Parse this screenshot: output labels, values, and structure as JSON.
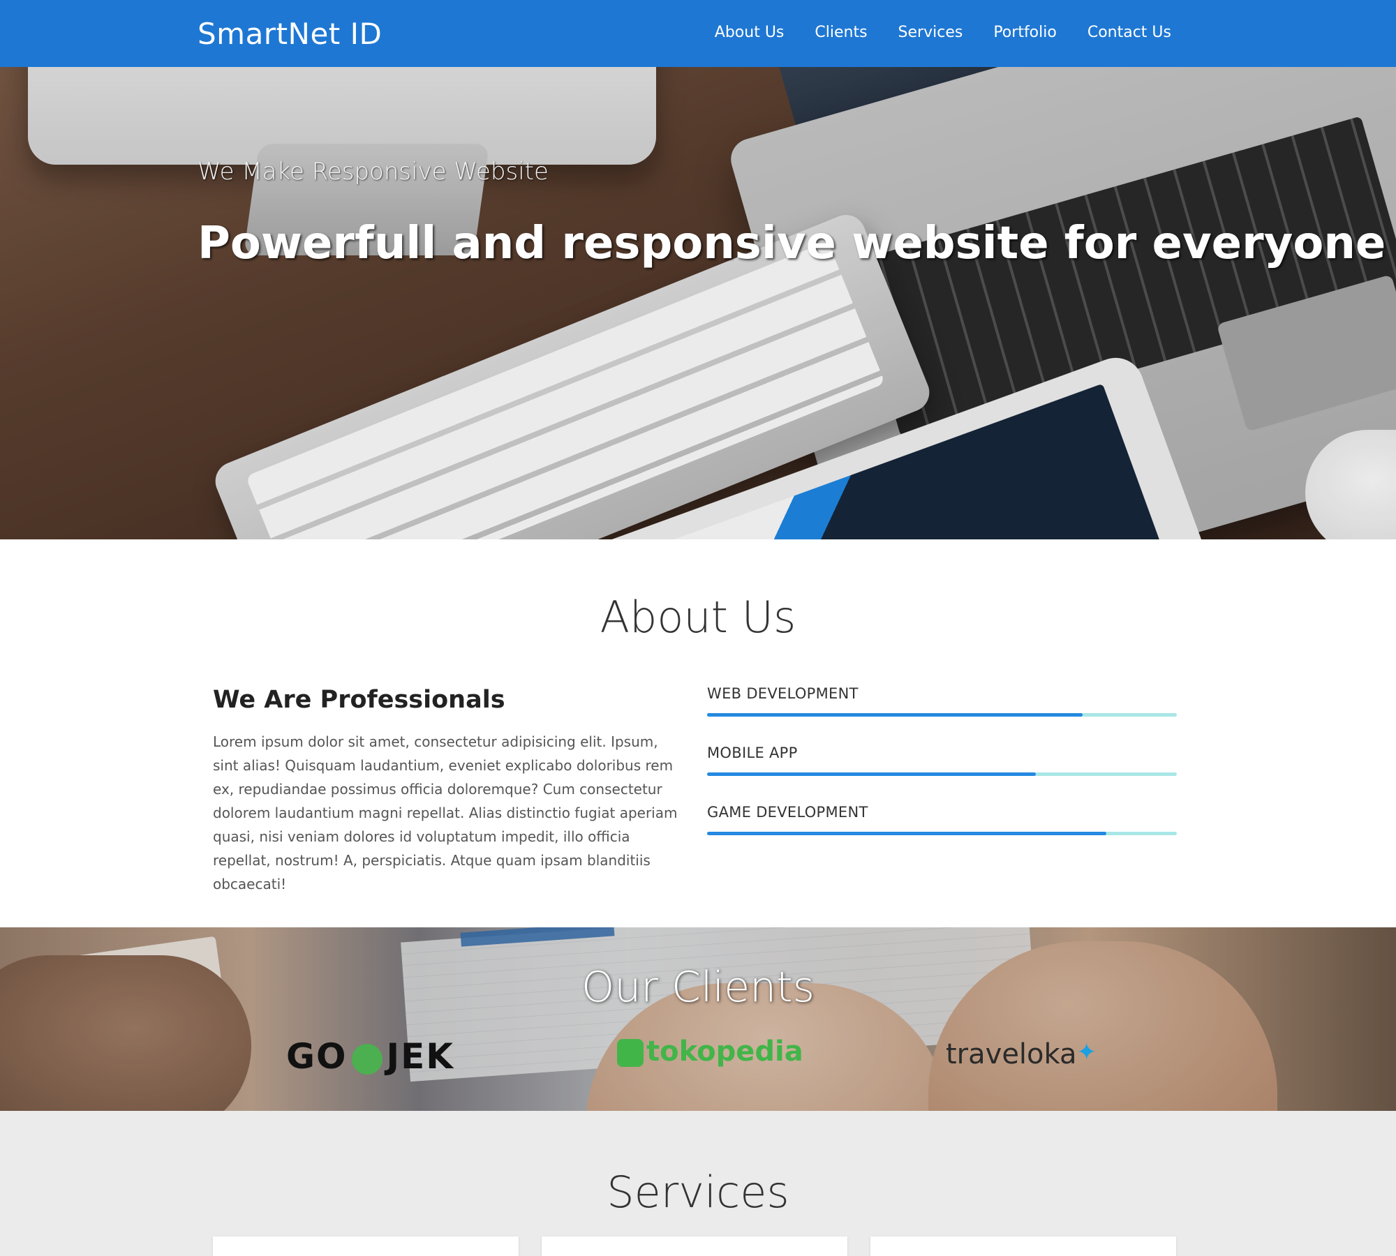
{
  "navbar": {
    "brand": "SmartNet ID",
    "links": [
      "About Us",
      "Clients",
      "Services",
      "Portfolio",
      "Contact Us"
    ],
    "background": "#1e77d3"
  },
  "hero": {
    "subtitle": "We Make Responsive Website",
    "title": "Powerfull and responsive website for everyone"
  },
  "about": {
    "title": "About Us",
    "heading": "We Are Professionals",
    "text": "Lorem ipsum dolor sit amet, consectetur adipisicing elit. Ipsum, sint alias! Quisquam laudantium, eveniet explicabo doloribus rem ex, repudiandae possimus officia doloremque? Cum consectetur dolorem laudantium magni repellat. Alias distinctio fugiat aperiam quasi, nisi veniam dolores id voluptatum impedit, illo officia repellat, nostrum! A, perspiciatis. Atque quam ipsam blanditiis obcaecati!",
    "skills": [
      {
        "label": "WEB DEVELOPMENT",
        "percent": 80
      },
      {
        "label": "MOBILE APP",
        "percent": 70
      },
      {
        "label": "GAME DEVELOPMENT",
        "percent": 85
      }
    ],
    "bar_color": "#2489e0",
    "track_color": "#a9e6e6"
  },
  "clients": {
    "title": "Our Clients",
    "logos": [
      {
        "name": "GO JEK",
        "left": "GO",
        "right": "JEK"
      },
      {
        "name": "tokopedia"
      },
      {
        "name": "traveloka"
      }
    ]
  },
  "services": {
    "title": "Services"
  }
}
